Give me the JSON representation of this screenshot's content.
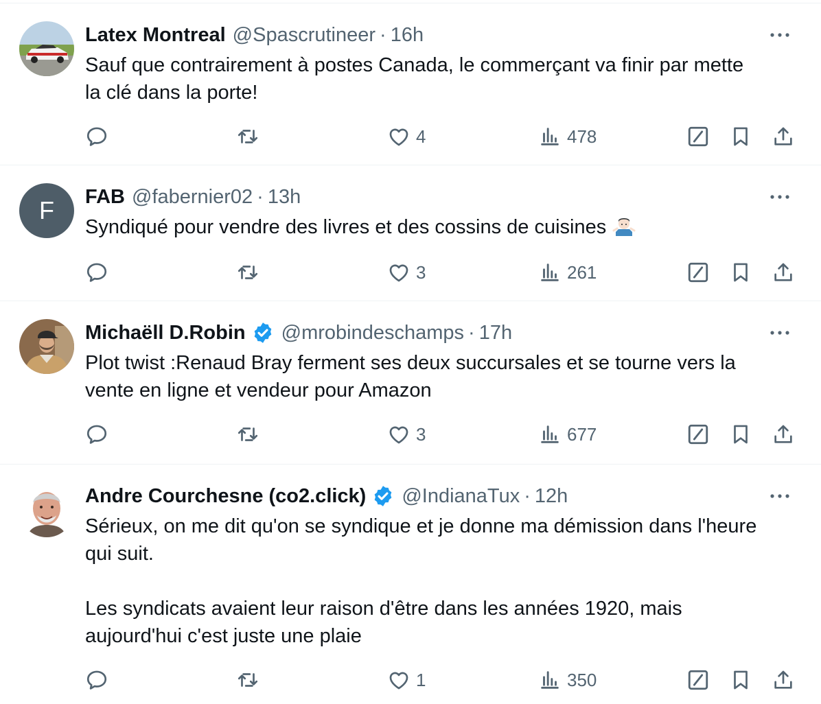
{
  "colors": {
    "secondary": "#536471",
    "verified": "#1d9bf0",
    "text": "#0f1419"
  },
  "tweets": [
    {
      "name": "Latex Montreal",
      "handle": "@Spascrutineer",
      "separator": "·",
      "time": "16h",
      "verified": false,
      "avatar": "race-car-photo",
      "text": "Sauf que contrairement à postes Canada, le commerçant va finir par mette\nla clé dans la porte!",
      "likes": "4",
      "views": "478"
    },
    {
      "name": "FAB",
      "handle": "@fabernier02",
      "separator": "·",
      "time": "13h",
      "verified": false,
      "avatar_letter": "F",
      "text": "Syndiqué pour vendre des livres et des cossins de cuisines",
      "emoji": "person-shrugging",
      "likes": "3",
      "views": "261"
    },
    {
      "name": "Michaëll D.Robin",
      "handle": "@mrobindeschamps",
      "separator": "·",
      "time": "17h",
      "verified": true,
      "avatar": "man-with-cap-photo",
      "text": "Plot twist :Renaud Bray ferment ses deux succursales et se tourne vers la\nvente en ligne et vendeur pour Amazon",
      "likes": "3",
      "views": "677"
    },
    {
      "name": "Andre Courchesne (co2.click)",
      "handle": "@IndianaTux",
      "separator": "·",
      "time": "12h",
      "verified": true,
      "avatar": "smiling-man-photo",
      "text": "Sérieux, on me dit qu'on se syndique et je donne ma démission dans l'heure\nqui suit.\n\nLes syndicats avaient leur raison d'être dans les années 1920, mais\naujourd'hui c'est juste une plaie",
      "likes": "1",
      "views": "350"
    }
  ]
}
